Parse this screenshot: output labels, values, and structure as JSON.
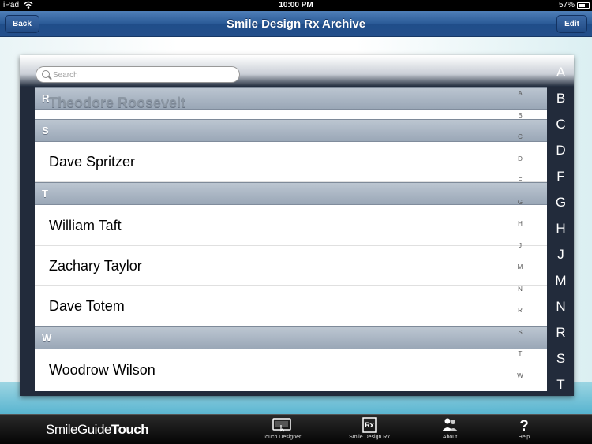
{
  "status_bar": {
    "carrier": "iPad",
    "time": "10:00 PM",
    "battery": "57%"
  },
  "nav": {
    "back_label": "Back",
    "title": "Smile Design Rx Archive",
    "edit_label": "Edit"
  },
  "search": {
    "placeholder": "Search"
  },
  "ghost_row": "Theodore Roosevelt",
  "sections": [
    {
      "letter": "R"
    },
    {
      "letter": "S",
      "rows": [
        "Dave Spritzer"
      ]
    },
    {
      "letter": "T",
      "rows": [
        "William  Taft",
        "Zachary  Taylor",
        "Dave Totem"
      ]
    },
    {
      "letter": "W",
      "rows": [
        "Woodrow  Wilson"
      ]
    }
  ],
  "mini_index": [
    "A",
    "B",
    "C",
    "D",
    "F",
    "G",
    "H",
    "J",
    "M",
    "N",
    "R",
    "S",
    "T",
    "W"
  ],
  "index_bar": [
    "A",
    "B",
    "C",
    "D",
    "F",
    "G",
    "H",
    "J",
    "M",
    "N",
    "R",
    "S",
    "T"
  ],
  "tab_bar": {
    "brand_light": "SmileGuide",
    "brand_bold": "Touch",
    "tabs": [
      {
        "label": "Touch Designer",
        "icon": "touch-designer-icon"
      },
      {
        "label": "Smile Design Rx",
        "icon": "rx-icon"
      },
      {
        "label": "About",
        "icon": "people-icon"
      },
      {
        "label": "Help",
        "icon": "question-icon"
      }
    ]
  }
}
